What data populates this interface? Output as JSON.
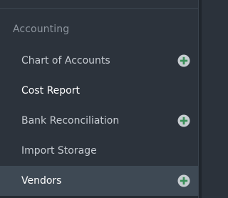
{
  "sidebar": {
    "section_heading": "Accounting",
    "items": [
      {
        "label": "Chart of Accounts",
        "has_expand": true,
        "active": false
      },
      {
        "label": "Cost Report",
        "has_expand": false,
        "active": false
      },
      {
        "label": "Bank Reconciliation",
        "has_expand": true,
        "active": false
      },
      {
        "label": "Import Storage",
        "has_expand": false,
        "active": false
      },
      {
        "label": "Vendors",
        "has_expand": true,
        "active": true
      }
    ],
    "expand_icon": "plus-circle-icon"
  },
  "colors": {
    "background": "#2c333c",
    "active_background": "#3e4954",
    "accent_green": "#8fd19e",
    "icon_circle": "#c7ccd1"
  }
}
